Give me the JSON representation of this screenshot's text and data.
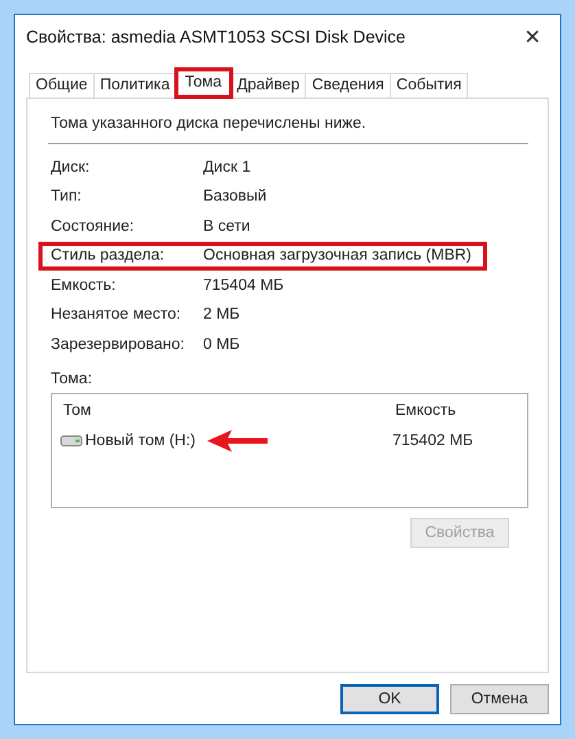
{
  "window": {
    "title": "Свойства: asmedia ASMT1053 SCSI Disk Device",
    "close": "✕"
  },
  "tabs": [
    {
      "label": "Общие",
      "selected": false,
      "highlighted": false
    },
    {
      "label": "Политика",
      "selected": false,
      "highlighted": false
    },
    {
      "label": "Тома",
      "selected": true,
      "highlighted": true
    },
    {
      "label": "Драйвер",
      "selected": false,
      "highlighted": false
    },
    {
      "label": "Сведения",
      "selected": false,
      "highlighted": false
    },
    {
      "label": "События",
      "selected": false,
      "highlighted": false
    }
  ],
  "description": "Тома указанного диска перечислены ниже.",
  "properties": [
    {
      "label": "Диск:",
      "value": "Диск 1",
      "highlighted": false
    },
    {
      "label": "Тип:",
      "value": "Базовый",
      "highlighted": false
    },
    {
      "label": "Состояние:",
      "value": "В сети",
      "highlighted": false
    },
    {
      "label": "Стиль раздела:",
      "value": "Основная загрузочная запись (MBR)",
      "highlighted": true
    },
    {
      "label": "Емкость:",
      "value": "715404 МБ",
      "highlighted": false
    },
    {
      "label": "Незанятое место:",
      "value": "2 МБ",
      "highlighted": false
    },
    {
      "label": "Зарезервировано:",
      "value": "0 МБ",
      "highlighted": false
    }
  ],
  "volumes_label": "Тома:",
  "volumes": {
    "columns": [
      "Том",
      "Емкость"
    ],
    "rows": [
      {
        "name": "Новый том (H:)",
        "capacity": "715402 МБ",
        "arrow": true
      }
    ]
  },
  "properties_button": {
    "label": "Свойства",
    "disabled": true
  },
  "buttons": [
    {
      "label": "OK",
      "default": true
    },
    {
      "label": "Отмена",
      "default": false
    }
  ]
}
